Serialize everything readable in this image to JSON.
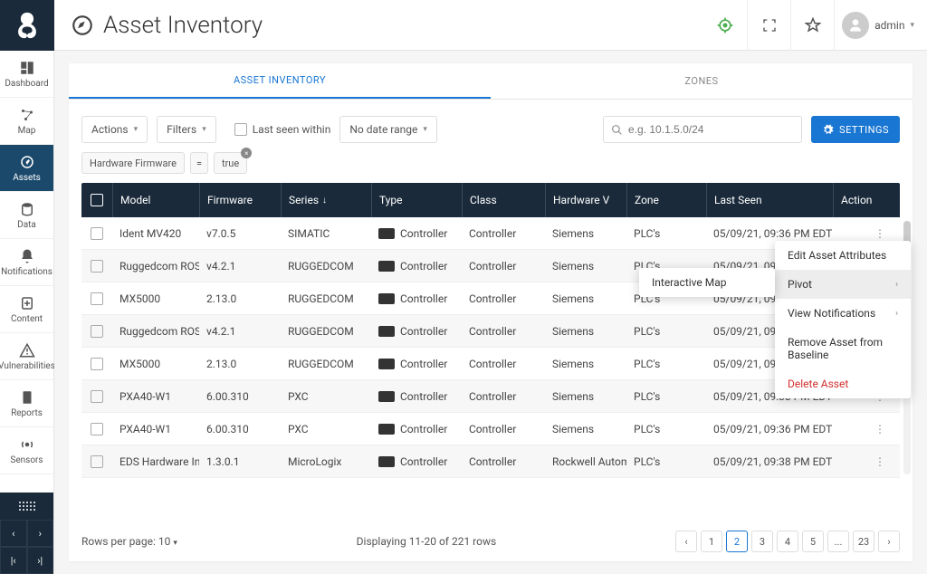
{
  "app": {
    "title": "Asset Inventory",
    "user": "admin"
  },
  "sidebar": [
    {
      "label": "Dashboard"
    },
    {
      "label": "Map"
    },
    {
      "label": "Assets"
    },
    {
      "label": "Data"
    },
    {
      "label": "Notifications"
    },
    {
      "label": "Content"
    },
    {
      "label": "Vulnerabilities"
    },
    {
      "label": "Reports"
    },
    {
      "label": "Sensors"
    }
  ],
  "tabs": {
    "inventory": "ASSET INVENTORY",
    "zones": "ZONES"
  },
  "toolbar": {
    "actions": "Actions",
    "filters": "Filters",
    "last_seen": "Last seen within",
    "date_range": "No date range",
    "search_ph": "e.g. 10.1.5.0/24",
    "settings": "SETTINGS"
  },
  "filter_chip": {
    "field": "Hardware Firmware",
    "op": "=",
    "value": "true"
  },
  "columns": {
    "model": "Model",
    "firmware": "Firmware",
    "series": "Series",
    "type": "Type",
    "class": "Class",
    "hardware": "Hardware V",
    "zone": "Zone",
    "last_seen": "Last Seen",
    "action": "Action"
  },
  "rows": [
    {
      "model": "Ident MV420",
      "fw": "v7.0.5",
      "series": "SIMATIC",
      "type": "Controller",
      "class": "Controller",
      "hw": "Siemens",
      "zone": "PLC's",
      "last": "05/09/21, 09:36 PM EDT"
    },
    {
      "model": "Ruggedcom ROS",
      "fw": "v4.2.1",
      "series": "RUGGEDCOM",
      "type": "Controller",
      "class": "Controller",
      "hw": "Siemens",
      "zone": "PLC's",
      "last": "05/09/21, 09:36 PM EDT"
    },
    {
      "model": "MX5000",
      "fw": "2.13.0",
      "series": "RUGGEDCOM",
      "type": "Controller",
      "class": "Controller",
      "hw": "Siemens",
      "zone": "PLC's",
      "last": "05/09/21, 09:36 PM EDT"
    },
    {
      "model": "Ruggedcom ROS",
      "fw": "v4.2.1",
      "series": "RUGGEDCOM",
      "type": "Controller",
      "class": "Controller",
      "hw": "Siemens",
      "zone": "PLC's",
      "last": "05/09/21, 09:36 PM EDT"
    },
    {
      "model": "MX5000",
      "fw": "2.13.0",
      "series": "RUGGEDCOM",
      "type": "Controller",
      "class": "Controller",
      "hw": "Siemens",
      "zone": "PLC's",
      "last": "05/09/21, 09:36 PM EDT"
    },
    {
      "model": "PXA40-W1",
      "fw": "6.00.310",
      "series": "PXC",
      "type": "Controller",
      "class": "Controller",
      "hw": "Siemens",
      "zone": "PLC's",
      "last": "05/09/21, 09:38 PM EDT"
    },
    {
      "model": "PXA40-W1",
      "fw": "6.00.310",
      "series": "PXC",
      "type": "Controller",
      "class": "Controller",
      "hw": "Siemens",
      "zone": "PLC's",
      "last": "05/09/21, 09:36 PM EDT"
    },
    {
      "model": "EDS Hardware Insta",
      "fw": "1.3.0.1",
      "series": "MicroLogix",
      "type": "Controller",
      "class": "Controller",
      "hw": "Rockwell Automatic",
      "zone": "PLC's",
      "last": "05/09/21, 09:38 PM EDT"
    }
  ],
  "footer": {
    "rpp_label": "Rows per page:",
    "rpp_value": "10",
    "summary": "Displaying 11-20 of 221 rows"
  },
  "pages": [
    "1",
    "2",
    "3",
    "4",
    "5",
    "...",
    "23"
  ],
  "context_menu": {
    "edit": "Edit Asset Attributes",
    "pivot": "Pivot",
    "pivot_sub": "Interactive Map",
    "notifications": "View Notifications",
    "remove": "Remove Asset from Baseline",
    "delete": "Delete Asset"
  }
}
